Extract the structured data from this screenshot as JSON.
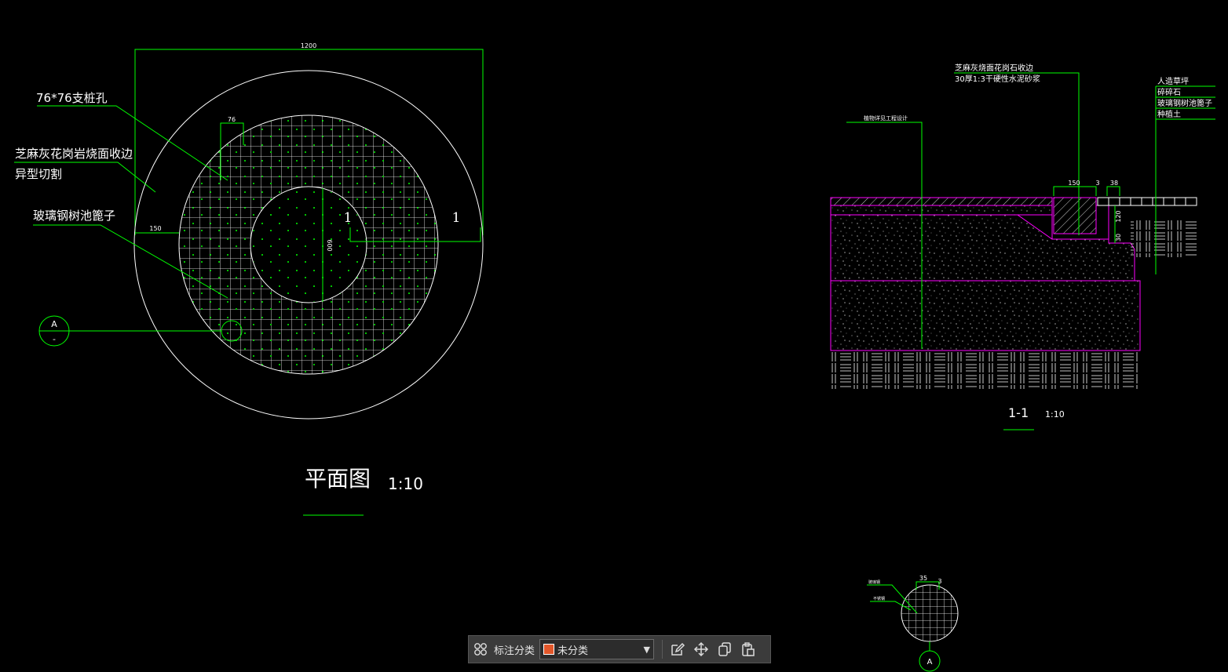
{
  "plan": {
    "title": "平面图",
    "scale": "1:10",
    "dim_overall": "1200",
    "dim_76": "76",
    "dim_150": "150",
    "dim_inner": "600",
    "label_pile_hole": "76*76支桩孔",
    "label_stone_edge_1": "芝麻灰花岗岩烧面收边",
    "label_stone_edge_2": "异型切割",
    "label_grate": "玻璃钢树池篦子",
    "section_mark": "1",
    "detail_mark": "A",
    "detail_sub": "-"
  },
  "section": {
    "title": "1-1",
    "scale": "1:10",
    "label_stone_1": "芝麻灰烧面花岗石收边",
    "label_stone_2": "30厚1:3干硬性水泥砂浆",
    "label_tree": "植物详见工程设计",
    "label_right_1": "人造草坪",
    "label_right_2": "碎碎石",
    "label_right_3": "玻璃钢树池篦子",
    "label_right_4": "种植土",
    "dim_150": "150",
    "dim_3": "3",
    "dim_38": "38",
    "dim_120": "120",
    "dim_30": "30"
  },
  "detail": {
    "dim_35": "35",
    "dim_3": "3",
    "label_1": "玻璃钢",
    "label_2": "不锈钢",
    "mark": "A"
  },
  "toolbar": {
    "label": "标注分类",
    "category_value": "未分类",
    "category_color": "#e2572a"
  },
  "colors": {
    "background": "#000000",
    "line_white": "#ffffff",
    "line_green": "#00ff00",
    "line_magenta": "#ff00ff"
  }
}
